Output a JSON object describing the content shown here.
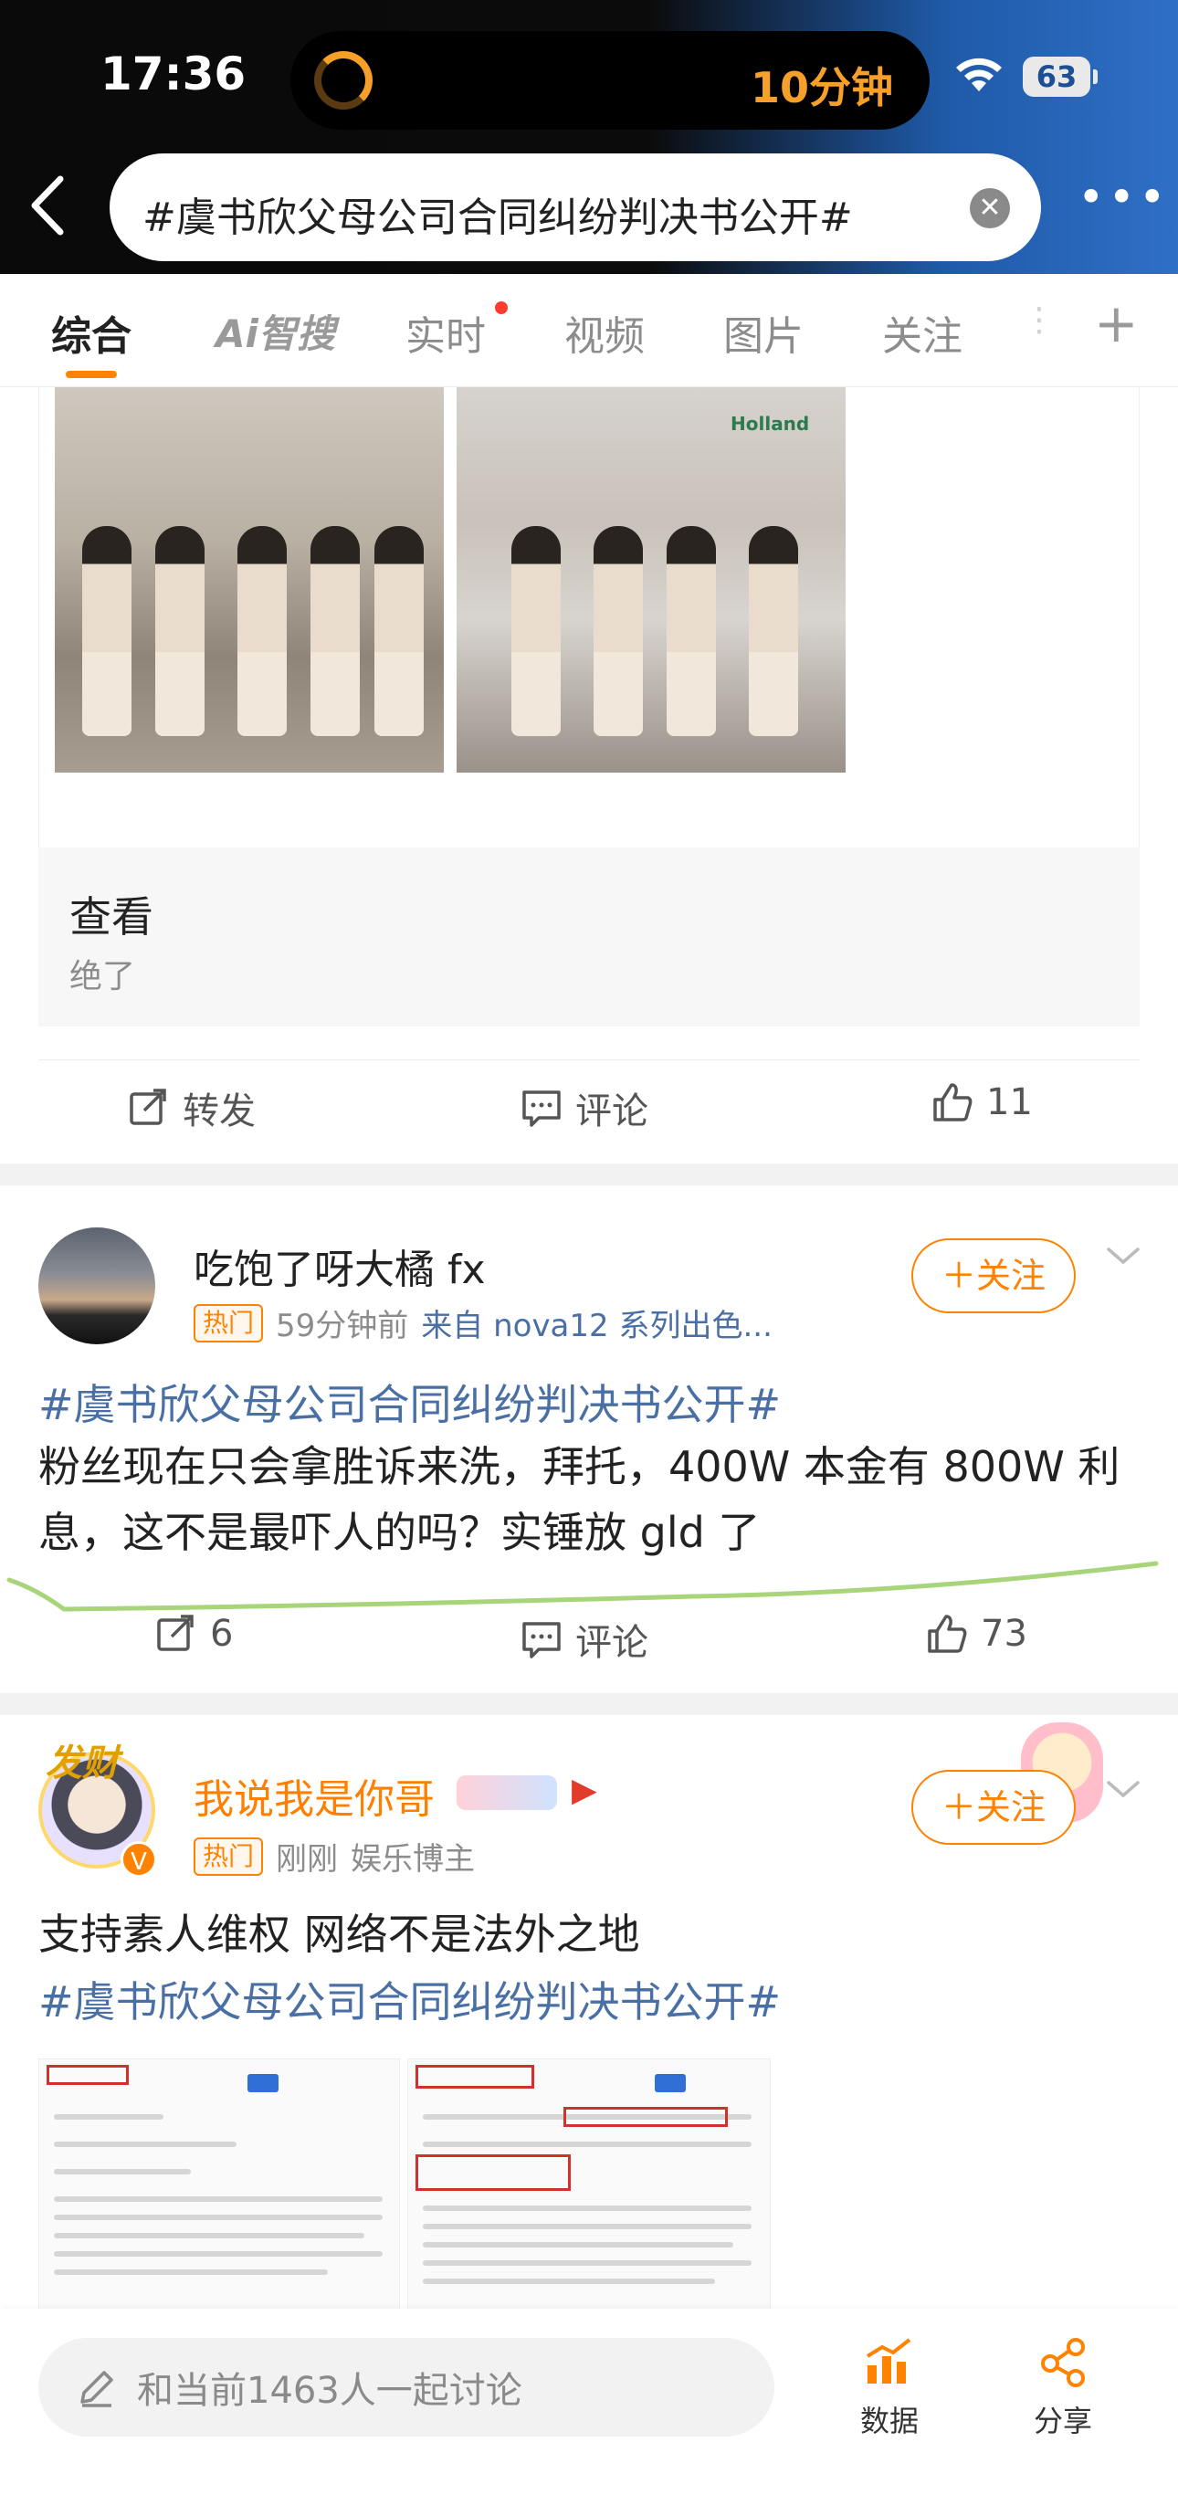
{
  "status_bar": {
    "time": "17:36",
    "timer": "10分钟",
    "battery": "63"
  },
  "search": {
    "query": "#虞书欣父母公司合同纠纷判决书公开#"
  },
  "tabs": [
    {
      "label": "综合",
      "active": true
    },
    {
      "label": "Ai智搜"
    },
    {
      "label": "实时",
      "dot": true
    },
    {
      "label": "视频"
    },
    {
      "label": "图片"
    },
    {
      "label": "关注"
    }
  ],
  "post1": {
    "photo_brand": "Holland",
    "card_title": "查看",
    "card_sub": "绝了",
    "actions": {
      "repost": "转发",
      "comment": "评论",
      "likes": "11"
    }
  },
  "post2": {
    "author": "吃饱了呀大橘 fx",
    "badge": "热门",
    "time": "59分钟前",
    "source": "来自 nova12 系列出色...",
    "follow": "＋关注",
    "hashtag": "#虞书欣父母公司合同纠纷判决书公开#",
    "text": "粉丝现在只会拿胜诉来洗，拜托，400W 本金有 800W 利息，这不是最吓人的吗？实锤放 gld 了",
    "actions": {
      "reposts": "6",
      "comment": "评论",
      "likes": "73"
    }
  },
  "post3": {
    "avatar_text": "发财",
    "author": "我说我是你哥",
    "badge": "热门",
    "time": "刚刚",
    "tag": "娱乐博主",
    "follow": "＋关注",
    "text": "支持素人维权 网络不是法外之地",
    "hashtag": "#虞书欣父母公司合同纠纷判决书公开#"
  },
  "bottom_bar": {
    "placeholder": "和当前1463人一起讨论",
    "data_label": "数据",
    "share_label": "分享"
  },
  "colors": {
    "accent": "#ff8200",
    "link": "#4a6fa5",
    "underline_stroke": "#a8d47a"
  }
}
